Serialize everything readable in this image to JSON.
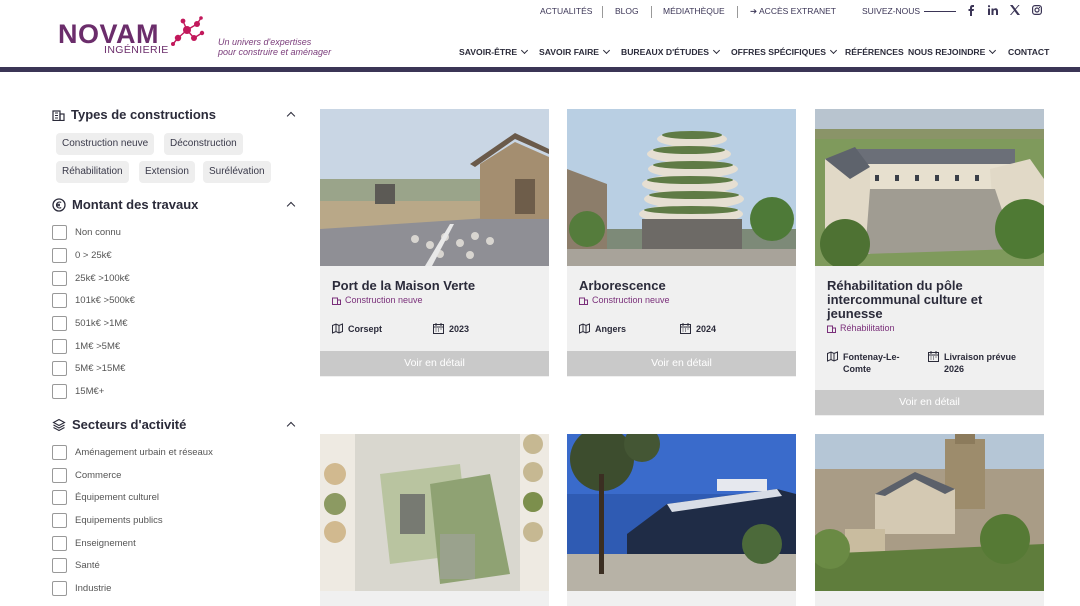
{
  "brand": {
    "name": "NOVAM",
    "subname": "INGÉNIERIE",
    "tagline_1": "Un univers d'expertises",
    "tagline_2": "pour construire et aménager"
  },
  "topnav": {
    "actualites": "ACTUALITÉS",
    "blog": "BLOG",
    "mediatheque": "MÉDIATHÈQUE",
    "extranet": "➔ ACCÈS EXTRANET",
    "suivez": "SUIVEZ-NOUS"
  },
  "social_icons": [
    "facebook-icon",
    "linkedin-icon",
    "x-icon",
    "instagram-icon"
  ],
  "mainnav": [
    {
      "label": "SAVOIR-ÊTRE",
      "dropdown": true
    },
    {
      "label": "SAVOIR FAIRE",
      "dropdown": true
    },
    {
      "label": "BUREAUX D'ÉTUDES",
      "dropdown": true
    },
    {
      "label": "OFFRES SPÉCIFIQUES",
      "dropdown": true
    },
    {
      "label": "RÉFÉRENCES",
      "dropdown": false
    },
    {
      "label": "NOUS REJOINDRE",
      "dropdown": true
    },
    {
      "label": "CONTACT",
      "dropdown": false
    }
  ],
  "filters": {
    "constructions": {
      "title": "Types de constructions",
      "tags": [
        "Construction neuve",
        "Déconstruction",
        "Réhabilitation",
        "Extension",
        "Surélévation"
      ]
    },
    "montant": {
      "title": "Montant des travaux",
      "options": [
        "Non connu",
        "0 > 25k€",
        "25k€ >100k€",
        "101k€ >500k€",
        "501k€ >1M€",
        "1M€ >5M€",
        "5M€ >15M€",
        "15M€+"
      ]
    },
    "secteurs": {
      "title": "Secteurs d'activité",
      "options": [
        "Aménagement urbain et réseaux",
        "Commerce",
        "Équipement culturel",
        "Equipements publics",
        "Enseignement",
        "Santé",
        "Industrie"
      ]
    }
  },
  "cards": [
    {
      "title": "Port de la Maison Verte",
      "type": "Construction neuve",
      "client": "Corsept",
      "year": "2023",
      "button": "Voir en détail"
    },
    {
      "title": "Arborescence",
      "type": "Construction neuve",
      "client": "Angers",
      "year": "2024",
      "button": "Voir en détail"
    },
    {
      "title": "Réhabilitation du pôle intercommunal culture et jeunesse",
      "type": "Réhabilitation",
      "client": "Fontenay-Le-Comte",
      "year": "Livraison prévue 2026",
      "button": "Voir en détail"
    }
  ],
  "colors": {
    "brand_purple": "#6b2d6b",
    "header_bar": "#3b3556",
    "accent_pink": "#c2185b",
    "button_grey": "#c9c9c9",
    "card_bg": "#f0f0f0"
  }
}
